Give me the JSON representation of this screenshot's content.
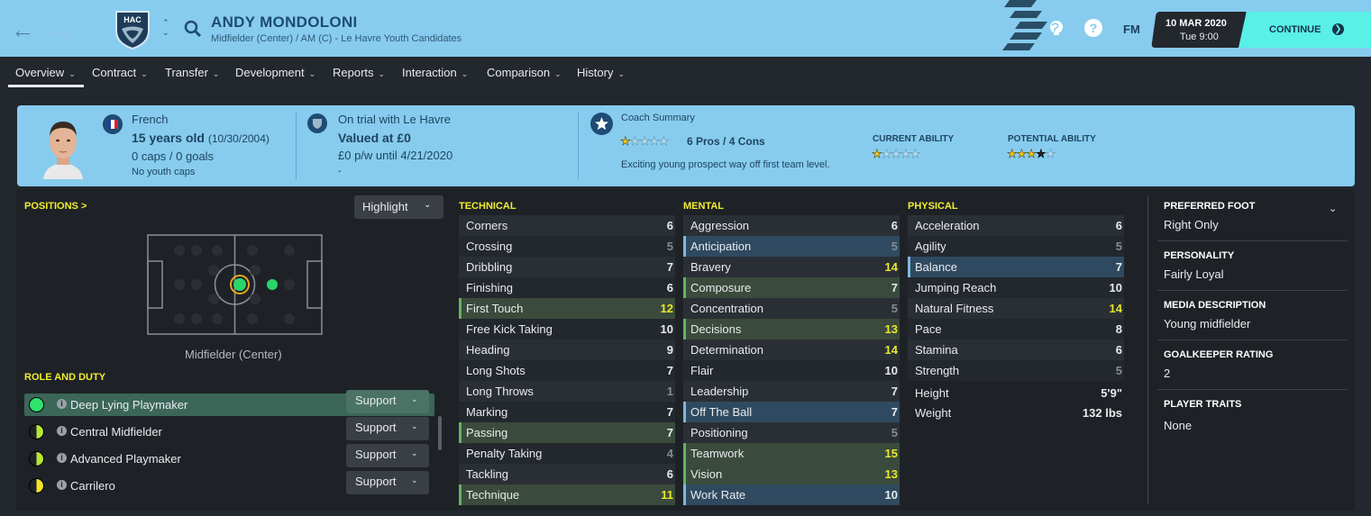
{
  "header": {
    "player_name": "ANDY MONDOLONI",
    "subtitle": "Midfielder (Center) / AM (C) - Le Havre Youth Candidates",
    "club_abbr": "HAC",
    "fm_label": "FM",
    "help_label": "?",
    "date": "10 MAR 2020",
    "time": "Tue 9:00",
    "continue_label": "CONTINUE"
  },
  "tabs": [
    {
      "label": "Overview"
    },
    {
      "label": "Contract"
    },
    {
      "label": "Transfer"
    },
    {
      "label": "Development"
    },
    {
      "label": "Reports"
    },
    {
      "label": "Interaction"
    },
    {
      "label": "Comparison"
    },
    {
      "label": "History"
    }
  ],
  "info": {
    "nationality": "French",
    "age": "15 years old",
    "dob": "(10/30/2004)",
    "caps": "0 caps / 0 goals",
    "youth_caps": "No youth caps",
    "club_status": "On trial with Le Havre",
    "value": "Valued at £0",
    "wage": "£0 p/w until 4/21/2020",
    "wage_extra": "-",
    "coach_title": "Coach Summary",
    "coach_rating": 1,
    "pros_cons": "6 Pros / 4 Cons",
    "coach_text": "Exciting young prospect way off first team level.",
    "current_ability_label": "CURRENT ABILITY",
    "current_ability_stars": 0.5,
    "potential_ability_label": "POTENTIAL ABILITY",
    "potential_ability_stars": 3.5
  },
  "positions": {
    "title": "POSITIONS >",
    "highlight_label": "Highlight",
    "position_label": "Midfielder (Center)"
  },
  "roles": {
    "title": "ROLE AND DUTY",
    "items": [
      {
        "name": "Deep Lying Playmaker",
        "duty": "Support",
        "suitability": "full"
      },
      {
        "name": "Central Midfielder",
        "duty": "Support",
        "suitability": "half"
      },
      {
        "name": "Advanced Playmaker",
        "duty": "Support",
        "suitability": "half"
      },
      {
        "name": "Carrilero",
        "duty": "Support",
        "suitability": "half-yellow"
      }
    ]
  },
  "technical": {
    "title": "TECHNICAL",
    "rows": [
      {
        "name": "Corners",
        "value": 6,
        "mark": ""
      },
      {
        "name": "Crossing",
        "value": 5,
        "mark": ""
      },
      {
        "name": "Dribbling",
        "value": 7,
        "mark": ""
      },
      {
        "name": "Finishing",
        "value": 6,
        "mark": ""
      },
      {
        "name": "First Touch",
        "value": 12,
        "mark": "key"
      },
      {
        "name": "Free Kick Taking",
        "value": 10,
        "mark": ""
      },
      {
        "name": "Heading",
        "value": 9,
        "mark": ""
      },
      {
        "name": "Long Shots",
        "value": 7,
        "mark": ""
      },
      {
        "name": "Long Throws",
        "value": 1,
        "mark": ""
      },
      {
        "name": "Marking",
        "value": 7,
        "mark": ""
      },
      {
        "name": "Passing",
        "value": 7,
        "mark": "key"
      },
      {
        "name": "Penalty Taking",
        "value": 4,
        "mark": ""
      },
      {
        "name": "Tackling",
        "value": 6,
        "mark": ""
      },
      {
        "name": "Technique",
        "value": 11,
        "mark": "key"
      }
    ]
  },
  "mental": {
    "title": "MENTAL",
    "rows": [
      {
        "name": "Aggression",
        "value": 6,
        "mark": ""
      },
      {
        "name": "Anticipation",
        "value": 5,
        "mark": "blue"
      },
      {
        "name": "Bravery",
        "value": 14,
        "mark": ""
      },
      {
        "name": "Composure",
        "value": 7,
        "mark": "key"
      },
      {
        "name": "Concentration",
        "value": 5,
        "mark": ""
      },
      {
        "name": "Decisions",
        "value": 13,
        "mark": "key"
      },
      {
        "name": "Determination",
        "value": 14,
        "mark": ""
      },
      {
        "name": "Flair",
        "value": 10,
        "mark": ""
      },
      {
        "name": "Leadership",
        "value": 7,
        "mark": ""
      },
      {
        "name": "Off The Ball",
        "value": 7,
        "mark": "blue"
      },
      {
        "name": "Positioning",
        "value": 5,
        "mark": ""
      },
      {
        "name": "Teamwork",
        "value": 15,
        "mark": "key"
      },
      {
        "name": "Vision",
        "value": 13,
        "mark": "key"
      },
      {
        "name": "Work Rate",
        "value": 10,
        "mark": "blue"
      }
    ]
  },
  "physical": {
    "title": "PHYSICAL",
    "rows": [
      {
        "name": "Acceleration",
        "value": 6,
        "mark": ""
      },
      {
        "name": "Agility",
        "value": 5,
        "mark": ""
      },
      {
        "name": "Balance",
        "value": 7,
        "mark": "blue"
      },
      {
        "name": "Jumping Reach",
        "value": 10,
        "mark": ""
      },
      {
        "name": "Natural Fitness",
        "value": 14,
        "mark": ""
      },
      {
        "name": "Pace",
        "value": 8,
        "mark": ""
      },
      {
        "name": "Stamina",
        "value": 6,
        "mark": ""
      },
      {
        "name": "Strength",
        "value": 5,
        "mark": ""
      }
    ],
    "height_label": "Height",
    "height": "5'9\"",
    "weight_label": "Weight",
    "weight": "132 lbs"
  },
  "side": {
    "preferred_foot_label": "PREFERRED FOOT",
    "preferred_foot": "Right Only",
    "personality_label": "PERSONALITY",
    "personality": "Fairly Loyal",
    "media_label": "MEDIA DESCRIPTION",
    "media": "Young midfielder",
    "gk_label": "GOALKEEPER RATING",
    "gk": "2",
    "traits_label": "PLAYER TRAITS",
    "traits": "None"
  },
  "colors": {
    "header_bg": "#87ccee",
    "accent_cyan": "#58f0e7",
    "section_title": "#f0ee2e",
    "key_attr_border": "#63b45c",
    "role_attr_border": "#7fb6dc"
  }
}
